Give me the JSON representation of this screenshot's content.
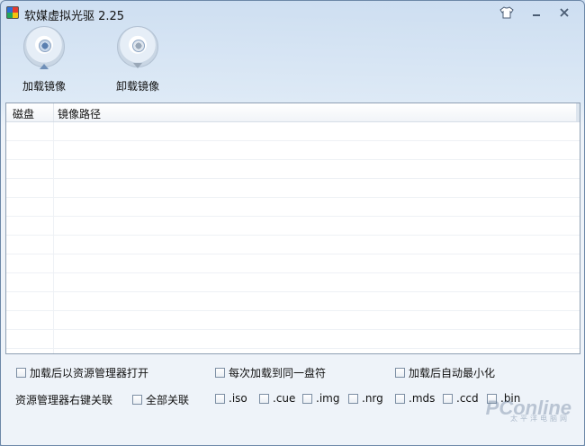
{
  "window": {
    "title": "软媒虚拟光驱 2.25"
  },
  "toolbar": {
    "mount_label": "加载镜像",
    "unmount_label": "卸载镜像"
  },
  "list": {
    "columns": [
      "磁盘",
      "镜像路径"
    ],
    "rows": []
  },
  "options": {
    "open_explorer": "加载后以资源管理器打开",
    "same_drive": "每次加载到同一盘符",
    "auto_minimize": "加载后自动最小化",
    "assoc_label": "资源管理器右键关联",
    "assoc_all": "全部关联",
    "extensions": [
      ".iso",
      ".cue",
      ".img",
      ".nrg",
      ".mds",
      ".ccd",
      ".bin"
    ]
  },
  "watermark": {
    "text": "PConline",
    "sub": "太平洋电脑网"
  }
}
